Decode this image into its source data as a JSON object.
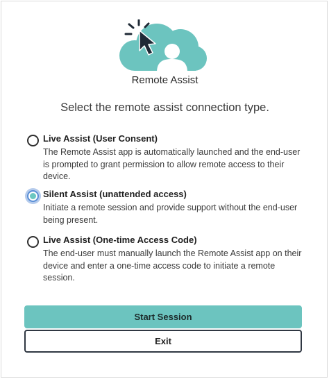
{
  "app": {
    "title": "Remote Assist"
  },
  "prompt": "Select the remote assist connection type.",
  "options": [
    {
      "label": "Live Assist (User Consent)",
      "description": "The Remote Assist app is automatically launched and the end-user is prompted to grant permission to allow remote access to their device.",
      "selected": false
    },
    {
      "label": "Silent Assist (unattended access)",
      "description": "Initiate a remote session and provide support without the end-user being present.",
      "selected": true
    },
    {
      "label": "Live Assist (One-time Access Code)",
      "description": "The end-user must manually launch the Remote Assist app on their device and enter a one-time access code to initiate a remote session.",
      "selected": false
    }
  ],
  "buttons": {
    "start_label": "Start Session",
    "exit_label": "Exit"
  },
  "colors": {
    "accent": "#6cc4bf",
    "logo_cloud": "#6cc4bf",
    "cursor": "#1f2a36",
    "selected_ring": "#5a8fd6"
  },
  "icons": {
    "logo": "cloud-user-cursor-icon"
  }
}
